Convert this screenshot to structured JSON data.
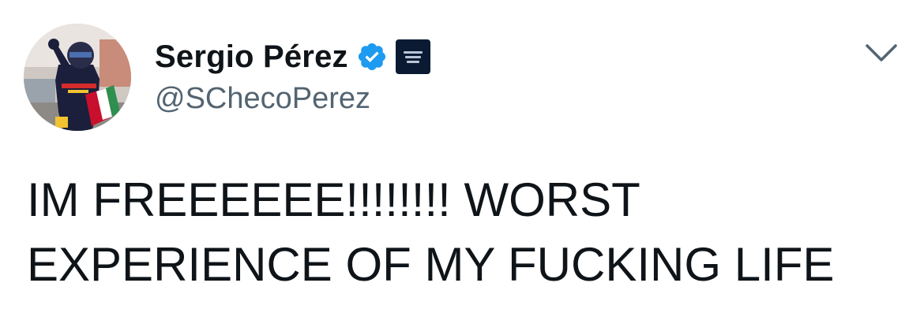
{
  "tweet": {
    "author": {
      "display_name": "Sergio Pérez",
      "handle": "@SChecoPerez",
      "verified": true,
      "verified_color": "#1d9bf0",
      "avatar": "user-avatar",
      "affiliate_badge": "team-affiliate-badge"
    },
    "text": "IM FREEEEEE!!!!!!!! WORST\nEXPERIENCE OF MY FUCKING LIFE",
    "menu_icon": "chevron-down-icon"
  }
}
